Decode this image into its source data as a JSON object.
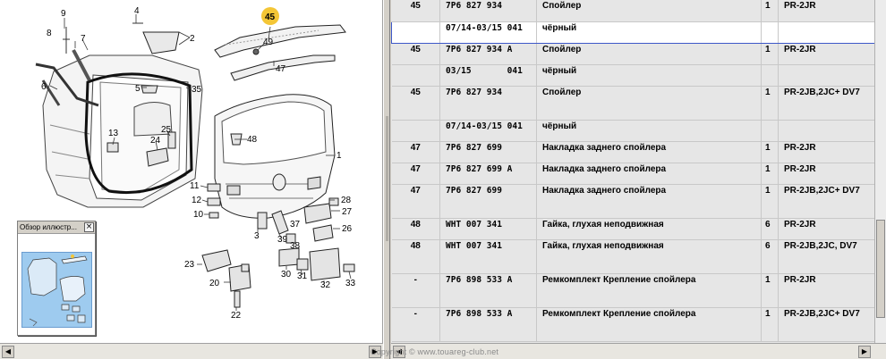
{
  "diagram": {
    "highlighted_callout": "45",
    "callouts": [
      "9",
      "4",
      "8",
      "7",
      "2",
      "45",
      "49",
      "47",
      "6",
      "5",
      "35",
      "1",
      "13",
      "25",
      "24",
      "48",
      "11",
      "12",
      "10",
      "28",
      "27",
      "3",
      "37",
      "39",
      "26",
      "23",
      "38",
      "30",
      "31",
      "32",
      "33",
      "20",
      "22"
    ],
    "highlight_color": "#f4c636"
  },
  "overview": {
    "title": "Обзор иллюстр...",
    "close_glyph": "×"
  },
  "table": {
    "rows": [
      {
        "pos": "45",
        "part": "7P6 827 934",
        "desc": "Спойлер",
        "qty": "1",
        "note": "PR-2JR"
      },
      {
        "pos": "",
        "part": "07/14-03/15 041",
        "desc": "чёрный",
        "qty": "",
        "note": "",
        "selected": true
      },
      {
        "pos": "45",
        "part": "7P6 827 934 A",
        "desc": "Спойлер",
        "qty": "1",
        "note": "PR-2JR"
      },
      {
        "pos": "",
        "part": "03/15       041",
        "desc": "чёрный",
        "qty": "",
        "note": ""
      },
      {
        "pos": "45",
        "part": "7P6 827 934",
        "desc": "Спойлер",
        "qty": "1",
        "note": "PR-2JB,2JC+ DV7"
      },
      {
        "pos": "",
        "part": "07/14-03/15 041",
        "desc": "чёрный",
        "qty": "",
        "note": ""
      },
      {
        "pos": "47",
        "part": "7P6 827 699",
        "desc": "Накладка заднего спойлера",
        "qty": "1",
        "note": "PR-2JR"
      },
      {
        "pos": "47",
        "part": "7P6 827 699 A",
        "desc": "Накладка заднего спойлера",
        "qty": "1",
        "note": "PR-2JR"
      },
      {
        "pos": "47",
        "part": "7P6 827 699",
        "desc": "Накладка заднего спойлера",
        "qty": "1",
        "note": "PR-2JB,2JC+ DV7"
      },
      {
        "pos": "48",
        "part": "WHT 007 341",
        "desc": "Гайка, глухая неподвижная",
        "qty": "6",
        "note": "PR-2JR"
      },
      {
        "pos": "48",
        "part": "WHT 007 341",
        "desc": "Гайка, глухая неподвижная",
        "qty": "6",
        "note": "PR-2JB,2JC, DV7"
      },
      {
        "pos": "-",
        "part": "7P6 898 533 A",
        "desc": "Ремкомплект Крепление спойлера",
        "qty": "1",
        "note": "PR-2JR"
      },
      {
        "pos": "-",
        "part": "7P6 898 533 A",
        "desc": "Ремкомплект Крепление спойлера",
        "qty": "1",
        "note": "PR-2JB,2JC+ DV7"
      }
    ]
  },
  "footer": {
    "copyright": "Copyright © www.touareg-club.net"
  },
  "scroll": {
    "left_arrow": "◀",
    "right_arrow": "▶",
    "up_arrow": "▲",
    "down_arrow": "▼"
  }
}
